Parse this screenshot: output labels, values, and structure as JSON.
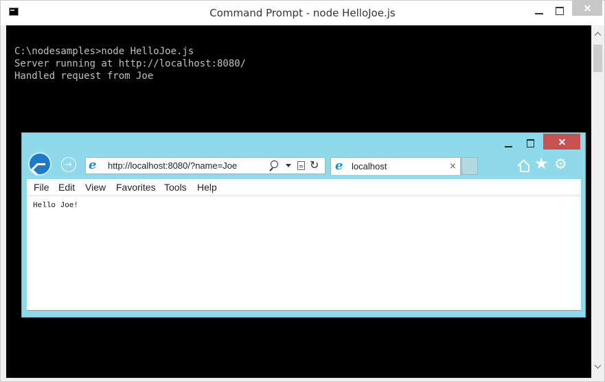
{
  "cmd": {
    "title": "Command Prompt - node  HelloJoe.js",
    "lines": [
      "C:\\nodesamples>node HelloJoe.js",
      "Server running at http://localhost:8080/",
      "Handled request from Joe"
    ],
    "colors": {
      "console_bg": "#000000",
      "console_text": "#c0c0c0"
    }
  },
  "ie": {
    "address_url": "http://localhost:8080/?name=Joe",
    "tab_label": "localhost",
    "tab_close": "×",
    "menu": [
      "File",
      "Edit",
      "View",
      "Favorites",
      "Tools",
      "Help"
    ],
    "page_text": "Hello Joe!",
    "icons": {
      "back": "back-arrow-icon",
      "forward": "forward-arrow-icon",
      "site": "ie-logo-icon",
      "search": "search-icon",
      "dropdown": "chevron-down-icon",
      "compat": "compatibility-view-icon",
      "refresh": "refresh-icon",
      "home": "home-icon",
      "favorites": "star-icon",
      "tools": "gear-icon"
    },
    "colors": {
      "frame": "#8ed9ea",
      "back_button": "#1e7ac8",
      "close_button": "#c75050"
    }
  }
}
